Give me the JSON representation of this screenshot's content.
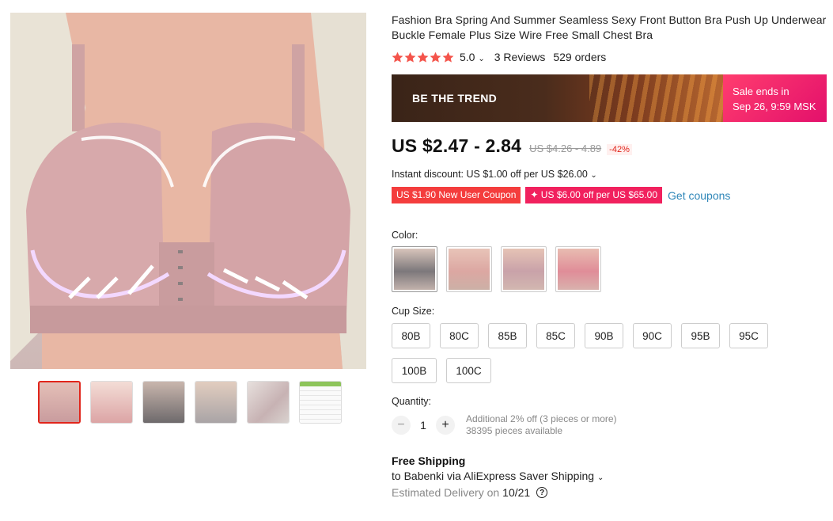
{
  "product": {
    "title": "Fashion Bra Spring And Summer Seamless Sexy Front Button Bra Push Up Underwear Buckle Female Plus Size Wire Free Small Chest Bra",
    "rating": "5.0",
    "reviews": "3 Reviews",
    "orders": "529 orders"
  },
  "banner": {
    "label": "BE THE TREND",
    "sale_line1": "Sale ends in",
    "sale_line2": "Sep 26, 9:59 MSK"
  },
  "price": {
    "current": "US $2.47 - 2.84",
    "original": "US $4.26 - 4.89",
    "discount": "-42%"
  },
  "instant_discount": "Instant discount: US $1.00 off per US $26.00",
  "coupons": [
    {
      "label": "US $1.90 New User Coupon"
    },
    {
      "label": "✦ US $6.00 off per US $65.00"
    }
  ],
  "get_coupons": "Get coupons",
  "color": {
    "label": "Color:",
    "swatches": [
      "gray",
      "pink-light",
      "pink-mauve",
      "pink-rose"
    ]
  },
  "cup_size": {
    "label": "Cup Size:",
    "options": [
      "80B",
      "80C",
      "85B",
      "85C",
      "90B",
      "90C",
      "95B",
      "95C",
      "100B",
      "100C"
    ]
  },
  "quantity": {
    "label": "Quantity:",
    "minus": "−",
    "value": "1",
    "plus": "+",
    "note": "Additional 2% off (3 pieces or more)",
    "available": "38395 pieces available"
  },
  "shipping": {
    "title": "Free Shipping",
    "subtitle": "to Babenki via AliExpress Saver Shipping",
    "delivery_prefix": "Estimated Delivery on",
    "delivery_date": "10/21",
    "help": "?"
  },
  "colors": {
    "accent_red": "#e1251b",
    "star": "#f4544b",
    "link_blue": "#2e86b8",
    "sale_pink": "#f1215e"
  }
}
